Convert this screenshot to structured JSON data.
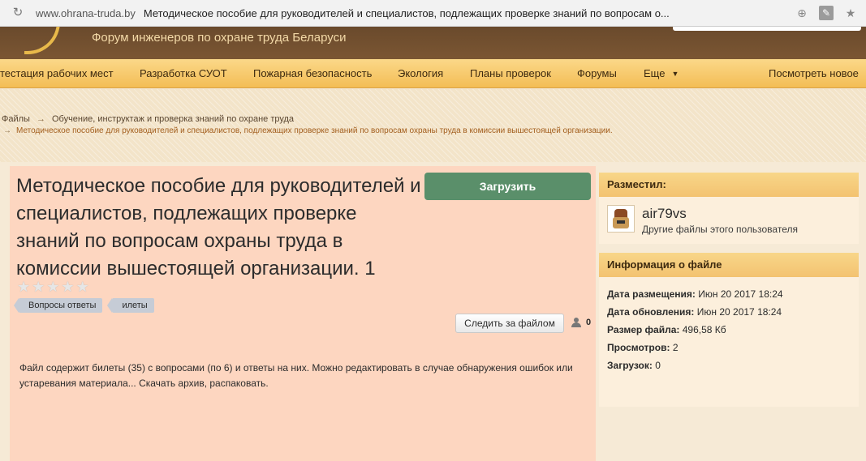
{
  "browser": {
    "url": "www.ohrana-truda.by",
    "title": "Методическое пособие для руководителей и специалистов, подлежащих проверке знаний по вопросам о..."
  },
  "header": {
    "slogan": "Форум инженеров по охране труда Беларуси"
  },
  "nav": {
    "items": [
      "тестация рабочих мест",
      "Разработка СУОТ",
      "Пожарная безопасность",
      "Экология",
      "Планы проверок",
      "Форумы",
      "Еще"
    ],
    "new_content": "Посмотреть новое"
  },
  "breadcrumb": {
    "level1": "Файлы",
    "level2": "Обучение, инструктаж и проверка знаний по охране труда",
    "level3": "Методическое пособие для руководителей и специалистов, подлежащих проверке знаний по вопросам охраны труда в комиссии вышестоящей организации.",
    "arrow": "→"
  },
  "file": {
    "title": "Методическое пособие для руководителей и специалистов, подлежащих проверке знаний по вопросам охраны труда в комиссии вышестоящей организации. 1",
    "upload_label": "Загрузить",
    "rating": 0,
    "tags": [
      "Вопросы ответы",
      "илеты"
    ],
    "follow_label": "Следить за файлом",
    "followers_count": "0",
    "description": "Файл содержит билеты (35) с вопросами (по 6) и ответы на них. Можно редактировать в случае обнаружения ошибок или устаревания материала... Скачать архив, распаковать."
  },
  "sidebar": {
    "posted_by_heading": "Разместил:",
    "username": "air79vs",
    "other_files": "Другие файлы этого пользователя",
    "info_heading": "Информация о файле",
    "info": [
      {
        "label": "Дата размещения:",
        "value": "Июн 20 2017 18:24"
      },
      {
        "label": "Дата обновления:",
        "value": "Июн 20 2017 18:24"
      },
      {
        "label": "Размер файла:",
        "value": "496,58 Кб"
      },
      {
        "label": "Просмотров:",
        "value": "2"
      },
      {
        "label": "Загрузок:",
        "value": "0"
      }
    ]
  }
}
